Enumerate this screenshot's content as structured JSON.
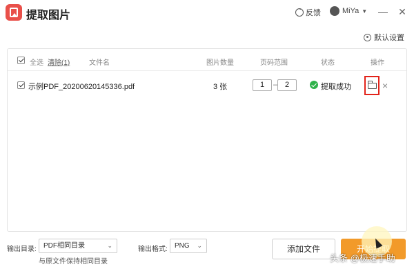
{
  "app": {
    "title": "提取图片",
    "feedback_label": "反馈",
    "user_name": "MiYa",
    "minimize": "—",
    "close": "✕"
  },
  "toolbar": {
    "settings_label": "默认设置"
  },
  "table": {
    "select_all": "全选",
    "clear_label": "清除(1)",
    "columns": {
      "filename": "文件名",
      "image_count": "图片数量",
      "page_range": "页码范围",
      "status": "状态",
      "action": "操作"
    },
    "rows": [
      {
        "checked": true,
        "filename": "示例PDF_20200620145336.pdf",
        "image_count": "3 张",
        "page_from": "1",
        "page_sep": "–",
        "page_to": "2",
        "status": "提取成功"
      }
    ]
  },
  "footer": {
    "output_dir_label": "输出目录:",
    "output_dir_value": "PDF相同目录",
    "output_format_label": "输出格式:",
    "output_format_value": "PNG",
    "keep_dir_hint": "与原文件保持相同目录",
    "add_file_label": "添加文件",
    "start_label": "开始提取"
  },
  "watermark": "头条 @极速手助",
  "colors": {
    "accent": "#f29a2a",
    "brand_red": "#e9504a",
    "success": "#2fb24a",
    "highlight_border": "#e2231a"
  }
}
